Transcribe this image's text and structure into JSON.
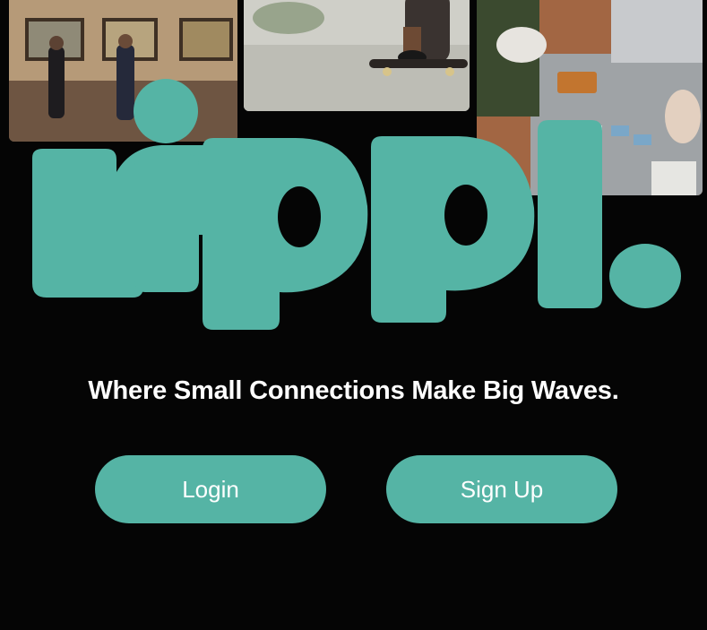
{
  "brand": {
    "logo_text": "rippl.",
    "color": "#55b4a5"
  },
  "tagline": "Where Small Connections Make Big Waves.",
  "actions": {
    "login_label": "Login",
    "signup_label": "Sign Up"
  },
  "photos": [
    "art-gallery-photo",
    "skateboarding-photo",
    "board-game-photo"
  ]
}
